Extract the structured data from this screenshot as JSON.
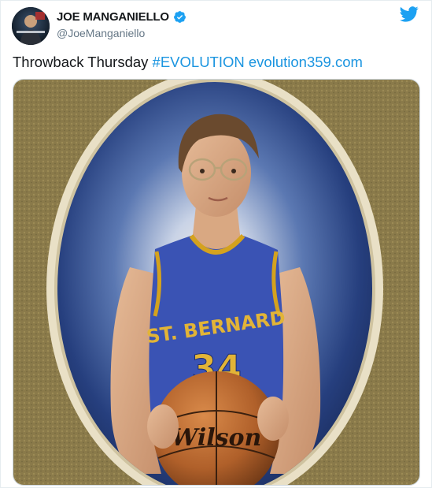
{
  "author": {
    "display_name": "JOE MANGANIELLO",
    "handle": "@JoeManganiello",
    "verified": true,
    "avatar_icon": "profile-photo"
  },
  "brand_icon": "twitter-bird-icon",
  "colors": {
    "link": "#1b95e0",
    "verified": "#1da1f2",
    "brand": "#1da1f2"
  },
  "tweet": {
    "text": "Throwback Thursday",
    "hashtag": "#EVOLUTION",
    "url": "evolution359.com"
  },
  "photo": {
    "description_icon": "school-portrait-photo",
    "jersey_team": "ST. BERNARD",
    "jersey_number": "34",
    "ball_brand": "Wilson"
  }
}
